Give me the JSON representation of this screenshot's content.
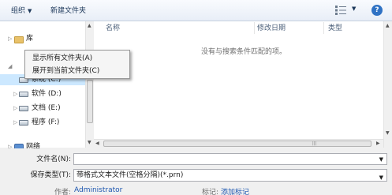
{
  "toolbar": {
    "organize_label": "组织",
    "organize_caret": "▼",
    "new_folder_label": "新建文件夹",
    "view_caret": "▼",
    "help_icon": "?"
  },
  "nav": {
    "library_label": "库",
    "drives": [
      {
        "label": "系统 (C:)",
        "icon": "drive-icon"
      },
      {
        "label": "软件 (D:)",
        "icon": "drive-icon"
      },
      {
        "label": "文档 (E:)",
        "icon": "drive-icon"
      },
      {
        "label": "程序 (F:)",
        "icon": "drive-icon"
      }
    ],
    "network_label": "网络"
  },
  "file_list": {
    "columns": [
      "名称",
      "修改日期",
      "类型"
    ],
    "empty_message": "没有与搜索条件匹配的项。"
  },
  "context_menu": {
    "items": [
      "显示所有文件夹(A)",
      "展开到当前文件夹(C)"
    ]
  },
  "form": {
    "filename_label": "文件名(N):",
    "filename_value": "",
    "filetype_label": "保存类型(T):",
    "filetype_value": "带格式文本文件(空格分隔)(*.prn)",
    "author_label": "作者:",
    "author_value": "Administrator",
    "tags_label": "标记:",
    "tags_value": "添加标记"
  },
  "colors": {
    "accent": "#2f72c4",
    "link": "#1e57b0"
  }
}
